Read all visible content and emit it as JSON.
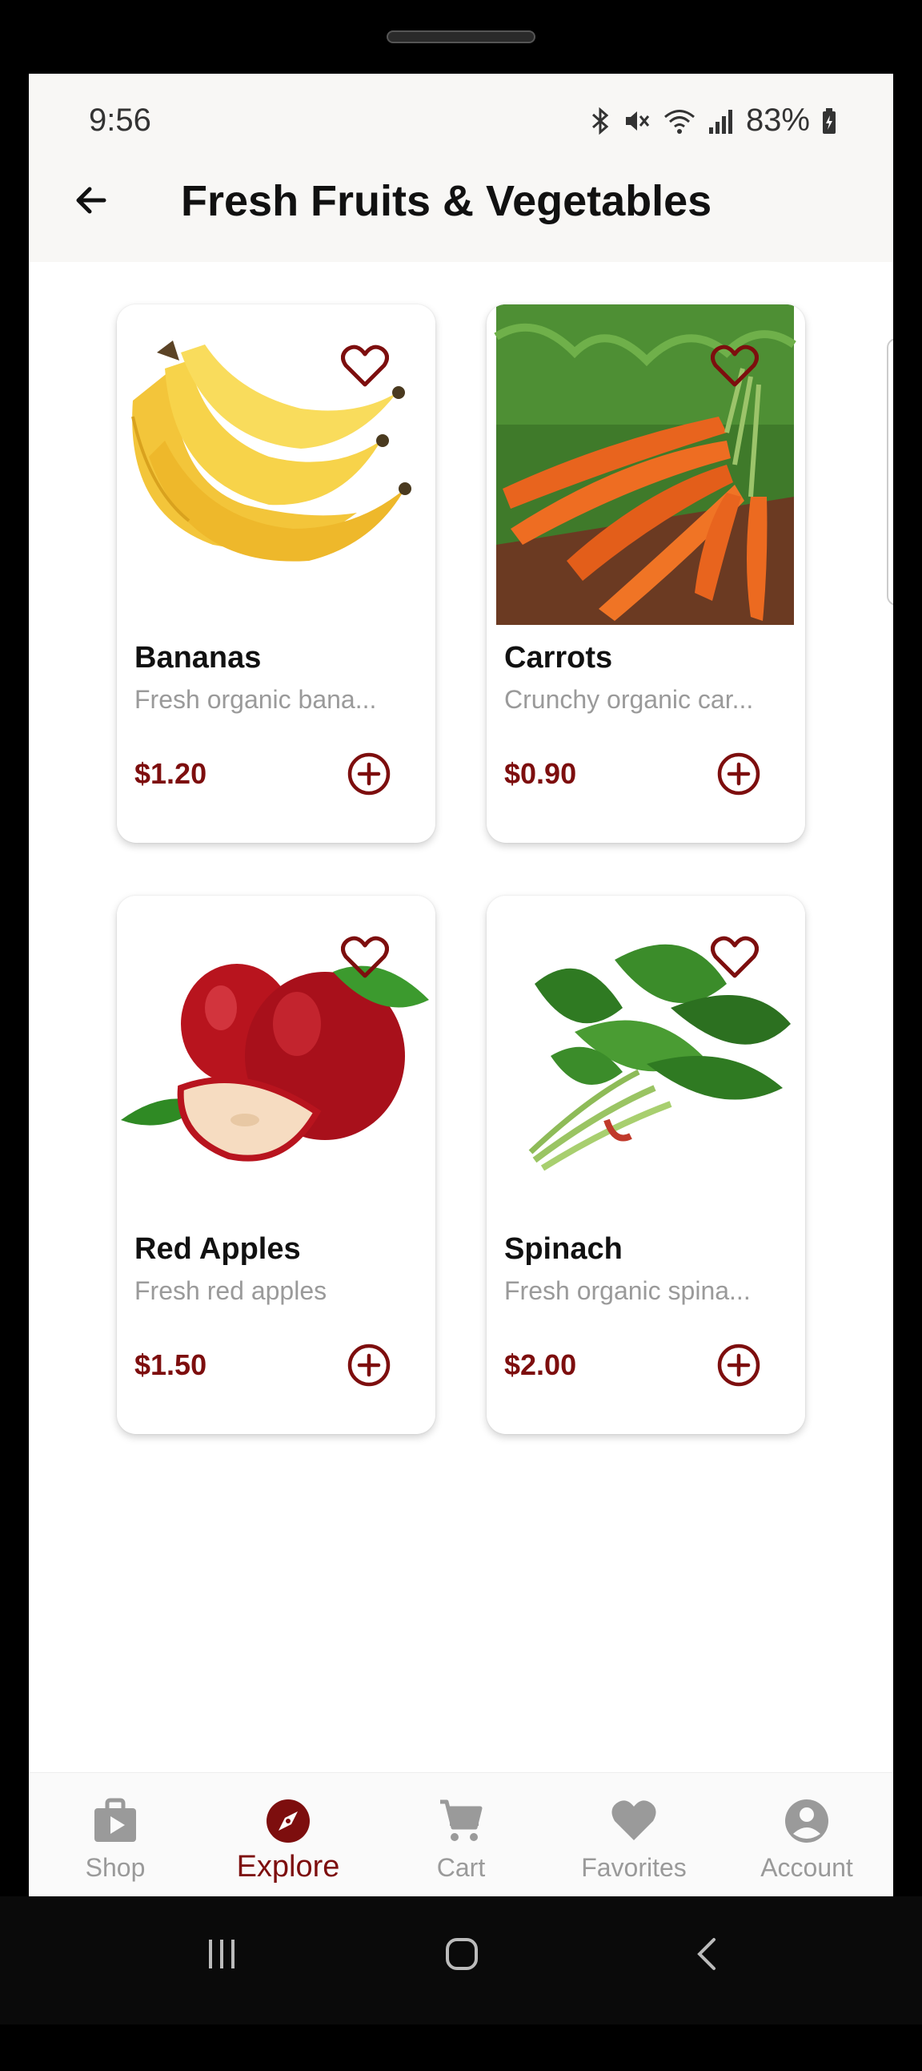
{
  "status": {
    "time": "9:56",
    "battery": "83%"
  },
  "header": {
    "title": "Fresh Fruits & Vegetables"
  },
  "products": [
    {
      "name": "Bananas",
      "desc": "Fresh organic bana...",
      "price": "$1.20"
    },
    {
      "name": "Carrots",
      "desc": "Crunchy organic car...",
      "price": "$0.90"
    },
    {
      "name": "Red Apples",
      "desc": "Fresh red apples",
      "price": "$1.50"
    },
    {
      "name": "Spinach",
      "desc": "Fresh organic spina...",
      "price": "$2.00"
    }
  ],
  "nav": [
    {
      "label": "Shop",
      "icon": "shop-bag-icon"
    },
    {
      "label": "Explore",
      "icon": "compass-icon",
      "active": true
    },
    {
      "label": "Cart",
      "icon": "cart-icon"
    },
    {
      "label": "Favorites",
      "icon": "heart-icon"
    },
    {
      "label": "Account",
      "icon": "account-icon"
    }
  ],
  "colors": {
    "accent": "#7d0e0e",
    "inactive": "#9a9a9a",
    "header_bg": "#f8f7f5"
  }
}
